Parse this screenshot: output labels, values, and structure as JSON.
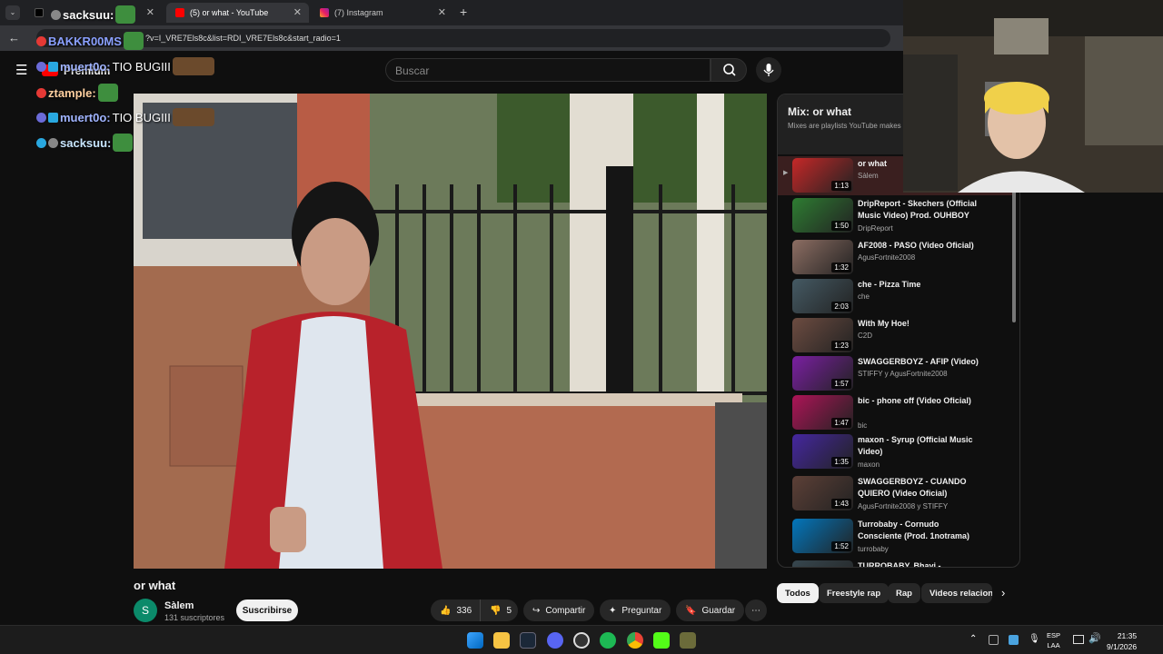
{
  "browser": {
    "tabs": [
      {
        "label": "",
        "active": false
      },
      {
        "label": "(5) or what - YouTube",
        "active": true
      },
      {
        "label": "(7) Instagram",
        "active": false
      }
    ],
    "new_tab": "+",
    "url": "?v=I_VRE7Els8c&list=RDI_VRE7Els8c&start_radio=1"
  },
  "header": {
    "premium_label": "Premium",
    "search_placeholder": "Buscar"
  },
  "chat": [
    {
      "user": "sacksuu:",
      "message": ""
    },
    {
      "user": "BAKKR00MS",
      "message": ""
    },
    {
      "user": "muert0o:",
      "message": "TIO BUGIII"
    },
    {
      "user": "ztample:",
      "message": ""
    },
    {
      "user": "muert0o:",
      "message": "TIO BUGIII"
    },
    {
      "user": "sacksuu:",
      "message": ""
    }
  ],
  "video": {
    "title": "or what",
    "channel": "Sàlem",
    "channel_initial": "S",
    "subscribers": "131 suscriptores",
    "subscribe_label": "Suscribirse",
    "likes": "336",
    "dislikes": "5",
    "share_label": "Compartir",
    "ask_label": "Preguntar",
    "save_label": "Guardar"
  },
  "playlist": {
    "title": "Mix: or what",
    "subtitle": "Mixes are playlists YouTube makes",
    "items": [
      {
        "title": "or what",
        "channel": "Sàlem",
        "duration": "1:13",
        "current": true
      },
      {
        "title": "DripReport - Skechers (Official Music Video) Prod. OUHBOY",
        "channel": "DripReport",
        "duration": "1:50"
      },
      {
        "title": "AF2008 - PASO (Video Oficial)",
        "channel": "AgusFortnite2008",
        "duration": "1:32"
      },
      {
        "title": "che - Pizza Time",
        "channel": "che",
        "duration": "2:03"
      },
      {
        "title": "With My Hoe!",
        "channel": "C2D",
        "duration": "1:23"
      },
      {
        "title": "SWAGGERBOYZ - AFIP (Video)",
        "channel": "STIFFY y AgusFortnite2008",
        "duration": "1:57"
      },
      {
        "title": "bic - phone off (Video Oficial)",
        "channel": "bic",
        "duration": "1:47"
      },
      {
        "title": "maxon - Syrup (Official Music Video)",
        "channel": "maxon",
        "duration": "1:35"
      },
      {
        "title": "SWAGGERBOYZ - CUANDO QUIERO (Video Oficial)",
        "channel": "AgusFortnite2008 y STIFFY",
        "duration": "1:43"
      },
      {
        "title": "Turrobaby - Cornudo Consciente (Prod. 1notrama)",
        "channel": "turrobaby",
        "duration": "1:52"
      },
      {
        "title": "TURROBABY, Bhavi -",
        "channel": "",
        "duration": ""
      }
    ]
  },
  "chips": [
    "Todos",
    "Freestyle rap",
    "Rap",
    "Videos relacion"
  ],
  "taskbar": {
    "lang_line1": "ESP",
    "lang_line2": "LAA",
    "time": "21:35",
    "date": "9/1/2026"
  },
  "colors": {
    "accent": "#ff0000",
    "background": "#0f0f0f",
    "panel_current": "#3a1f1f"
  }
}
